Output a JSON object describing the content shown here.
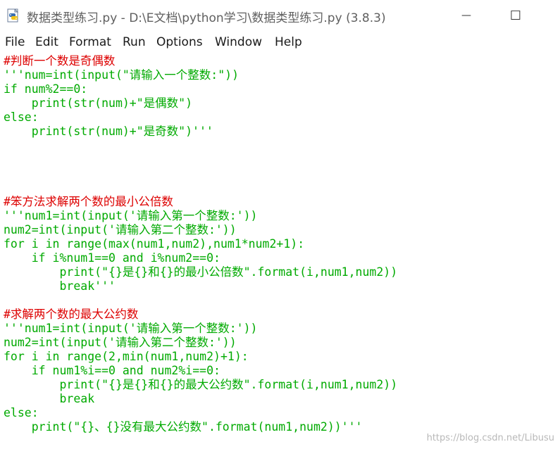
{
  "window": {
    "title": "数据类型练习.py - D:\\E文档\\python学习\\数据类型练习.py (3.8.3)",
    "minimize_glyph": "—",
    "maximize_glyph": "☐"
  },
  "menu": {
    "items": [
      "File",
      "Edit",
      "Format",
      "Run",
      "Options",
      "Window",
      "Help"
    ]
  },
  "editor": {
    "lines": [
      {
        "text": "#判断一个数是奇偶数",
        "kind": "comment"
      },
      {
        "text": "'''num=int(input(\"请输入一个整数:\"))",
        "kind": "string"
      },
      {
        "text": "if num%2==0:",
        "kind": "string"
      },
      {
        "text": "    print(str(num)+\"是偶数\")",
        "kind": "string"
      },
      {
        "text": "else:",
        "kind": "string"
      },
      {
        "text": "    print(str(num)+\"是奇数\")'''",
        "kind": "string"
      },
      {
        "text": "",
        "kind": "plain"
      },
      {
        "text": "",
        "kind": "plain"
      },
      {
        "text": "",
        "kind": "plain"
      },
      {
        "text": "",
        "kind": "plain"
      },
      {
        "text": "#笨方法求解两个数的最小公倍数",
        "kind": "comment"
      },
      {
        "text": "'''num1=int(input('请输入第一个整数:'))",
        "kind": "string"
      },
      {
        "text": "num2=int(input('请输入第二个整数:'))",
        "kind": "string"
      },
      {
        "text": "for i in range(max(num1,num2),num1*num2+1):",
        "kind": "string"
      },
      {
        "text": "    if i%num1==0 and i%num2==0:",
        "kind": "string"
      },
      {
        "text": "        print(\"{}是{}和{}的最小公倍数\".format(i,num1,num2))",
        "kind": "string"
      },
      {
        "text": "        break'''",
        "kind": "string"
      },
      {
        "text": "",
        "kind": "plain"
      },
      {
        "text": "#求解两个数的最大公约数",
        "kind": "comment"
      },
      {
        "text": "'''num1=int(input('请输入第一个整数:'))",
        "kind": "string"
      },
      {
        "text": "num2=int(input('请输入第二个整数:'))",
        "kind": "string"
      },
      {
        "text": "for i in range(2,min(num1,num2)+1):",
        "kind": "string"
      },
      {
        "text": "    if num1%i==0 and num2%i==0:",
        "kind": "string"
      },
      {
        "text": "        print(\"{}是{}和{}的最大公约数\".format(i,num1,num2))",
        "kind": "string"
      },
      {
        "text": "        break",
        "kind": "string"
      },
      {
        "text": "else:",
        "kind": "string"
      },
      {
        "text": "    print(\"{}、{}没有最大公约数\".format(num1,num2))'''",
        "kind": "string"
      }
    ]
  },
  "watermark": "https://blog.csdn.net/Libusu",
  "colors": {
    "comment": "#dd0000",
    "string": "#00aa00",
    "title_text": "#5f5f5f"
  },
  "icons": {
    "app": "python-idle-icon"
  }
}
